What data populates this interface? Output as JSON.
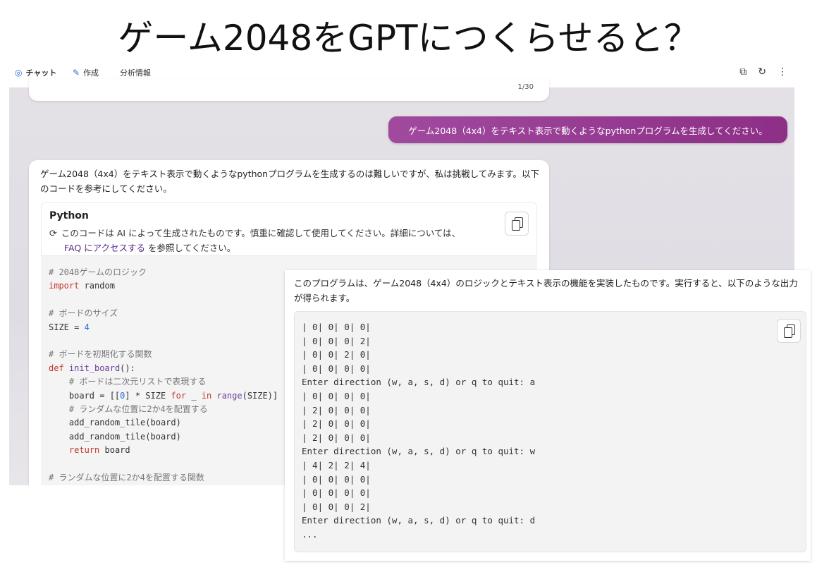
{
  "slide": {
    "title": "ゲーム2048をGPTにつくらせると？"
  },
  "nav": {
    "tabs": [
      {
        "icon": "chat-icon",
        "label": "チャット"
      },
      {
        "icon": "compose-icon",
        "label": "作成"
      },
      {
        "icon": "",
        "label": "分析情報"
      }
    ]
  },
  "prev_card": {
    "counter": "1/30"
  },
  "user_message": "ゲーム2048（4x4）をテキスト表示で動くようなpythonプログラムを生成してください。",
  "reply": {
    "intro": "ゲーム2048（4x4）をテキスト表示で動くようなpythonプログラムを生成するのは難しいですが、私は挑戦してみます。以下のコードを参考にしてください。",
    "code_language": "Python",
    "notice_prefix": "このコードは AI によって生成されたものです。慎重に確認して使用してください。詳細については、",
    "notice_link": "FAQ にアクセスする",
    "notice_suffix": " を参照してください。",
    "code_lines": [
      "# 2048ゲームのロジック",
      "import random",
      "",
      "# ボードのサイズ",
      "SIZE = 4",
      "",
      "# ボードを初期化する関数",
      "def init_board():",
      "    # ボードは二次元リストで表現する",
      "    board = [[0] * SIZE for _ in range(SIZE)]",
      "    # ランダムな位置に2か4を配置する",
      "    add_random_tile(board)",
      "    add_random_tile(board)",
      "    return board",
      "",
      "# ランダムな位置に2か4を配置する関数"
    ]
  },
  "output": {
    "intro": "このプログラムは、ゲーム2048（4x4）のロジックとテキスト表示の機能を実装したものです。実行すると、以下のような出力が得られます。",
    "lines": [
      "| 0| 0| 0| 0|",
      "| 0| 0| 0| 2|",
      "| 0| 0| 2| 0|",
      "| 0| 0| 0| 0|",
      "Enter direction (w, a, s, d) or q to quit: a",
      "| 0| 0| 0| 0|",
      "| 2| 0| 0| 0|",
      "| 2| 0| 0| 0|",
      "| 2| 0| 0| 0|",
      "Enter direction (w, a, s, d) or q to quit: w",
      "| 4| 2| 2| 4|",
      "| 0| 0| 0| 0|",
      "| 0| 0| 0| 0|",
      "| 0| 0| 0| 2|",
      "Enter direction (w, a, s, d) or q to quit: d",
      "..."
    ]
  },
  "colors": {
    "accent": "#2a6fd6",
    "user_bubble": "#8d2f86",
    "link": "#5a2a8c"
  }
}
